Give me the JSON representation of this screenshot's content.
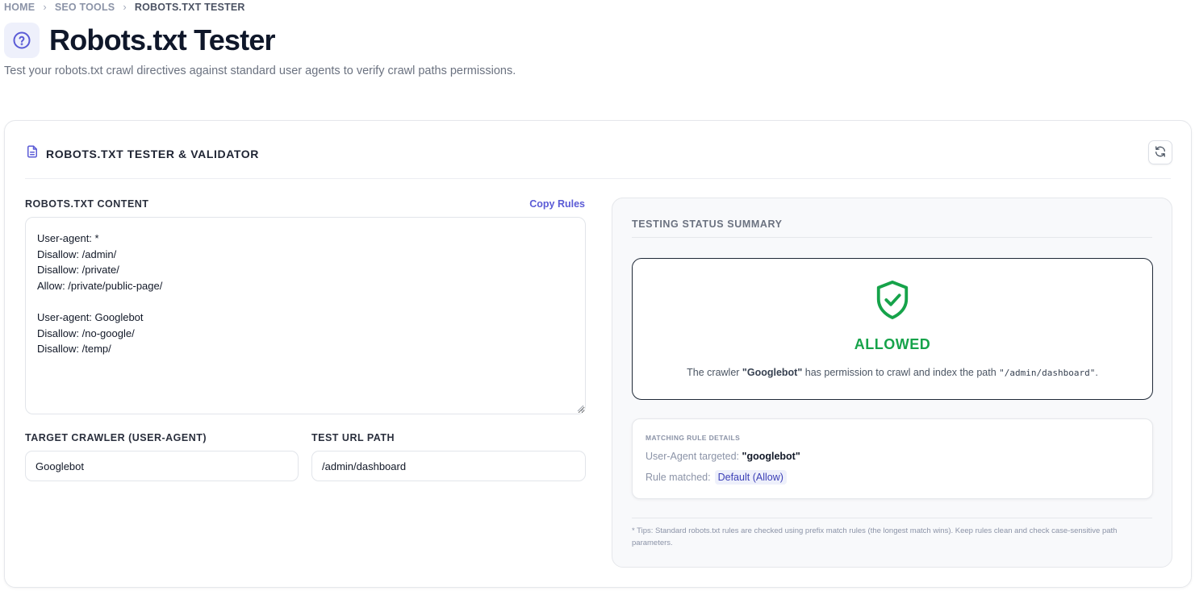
{
  "breadcrumb": {
    "home": "HOME",
    "section": "SEO TOOLS",
    "current": "ROBOTS.TXT TESTER"
  },
  "page": {
    "title": "Robots.txt Tester",
    "subtitle": "Test your robots.txt crawl directives against standard user agents to verify crawl paths permissions."
  },
  "card": {
    "title": "ROBOTS.TXT TESTER & VALIDATOR"
  },
  "editor": {
    "label": "ROBOTS.TXT CONTENT",
    "copy_label": "Copy Rules",
    "content": "User-agent: *\nDisallow: /admin/\nDisallow: /private/\nAllow: /private/public-page/\n\nUser-agent: Googlebot\nDisallow: /no-google/\nDisallow: /temp/"
  },
  "crawler": {
    "label": "TARGET CRAWLER (USER-AGENT)",
    "value": "Googlebot"
  },
  "path": {
    "label": "TEST URL PATH",
    "value": "/admin/dashboard"
  },
  "summary": {
    "label": "TESTING STATUS SUMMARY",
    "status": "ALLOWED",
    "desc_prefix": "The crawler ",
    "desc_agent": "\"Googlebot\"",
    "desc_middle": " has permission to crawl and index the path ",
    "desc_path": "\"/admin/dashboard\"",
    "desc_suffix": "."
  },
  "details": {
    "title": "MATCHING RULE DETAILS",
    "agent_label": "User-Agent targeted: ",
    "agent_value": "\"googlebot\"",
    "rule_label": "Rule matched:",
    "rule_value": "Default (Allow)"
  },
  "tips": "* Tips: Standard robots.txt rules are checked using prefix match rules (the longest match wins). Keep rules clean and check case-sensitive path parameters.",
  "colors": {
    "accent": "#5b5bd6",
    "allowed": "#16a34a"
  },
  "icons": {
    "title": "help-circle-icon",
    "card": "file-text-icon",
    "refresh": "refresh-icon",
    "status": "shield-check-icon"
  }
}
